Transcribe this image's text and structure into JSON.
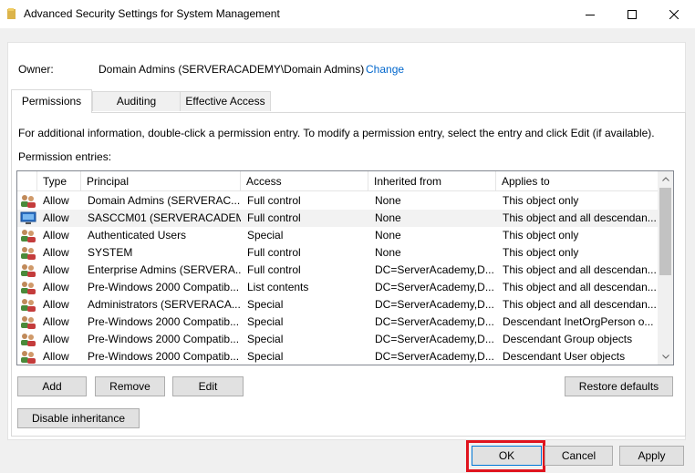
{
  "window": {
    "title": "Advanced Security Settings for System Management",
    "icon": "folder-icon"
  },
  "owner": {
    "label": "Owner:",
    "value": "Domain Admins (SERVERACADEMY\\Domain Admins)",
    "change_link": "Change"
  },
  "tabs": [
    {
      "label": "Permissions",
      "active": true
    },
    {
      "label": "Auditing",
      "active": false
    },
    {
      "label": "Effective Access",
      "active": false
    }
  ],
  "info_text": "For additional information, double-click a permission entry. To modify a permission entry, select the entry and click Edit (if available).",
  "entries_label": "Permission entries:",
  "columns": [
    "Type",
    "Principal",
    "Access",
    "Inherited from",
    "Applies to"
  ],
  "entries": [
    {
      "icon": "group-icon",
      "type": "Allow",
      "principal": "Domain Admins (SERVERAC...",
      "access": "Full control",
      "inherited": "None",
      "applies": "This object only"
    },
    {
      "icon": "computer-icon",
      "type": "Allow",
      "principal": "SASCCM01 (SERVERACADEM...",
      "access": "Full control",
      "inherited": "None",
      "applies": "This object and all descendan..."
    },
    {
      "icon": "group-icon",
      "type": "Allow",
      "principal": "Authenticated Users",
      "access": "Special",
      "inherited": "None",
      "applies": "This object only"
    },
    {
      "icon": "group-icon",
      "type": "Allow",
      "principal": "SYSTEM",
      "access": "Full control",
      "inherited": "None",
      "applies": "This object only"
    },
    {
      "icon": "group-icon",
      "type": "Allow",
      "principal": "Enterprise Admins (SERVERA...",
      "access": "Full control",
      "inherited": "DC=ServerAcademy,D...",
      "applies": "This object and all descendan..."
    },
    {
      "icon": "group-icon",
      "type": "Allow",
      "principal": "Pre-Windows 2000 Compatib...",
      "access": "List contents",
      "inherited": "DC=ServerAcademy,D...",
      "applies": "This object and all descendan..."
    },
    {
      "icon": "group-icon",
      "type": "Allow",
      "principal": "Administrators (SERVERACA...",
      "access": "Special",
      "inherited": "DC=ServerAcademy,D...",
      "applies": "This object and all descendan..."
    },
    {
      "icon": "group-icon",
      "type": "Allow",
      "principal": "Pre-Windows 2000 Compatib...",
      "access": "Special",
      "inherited": "DC=ServerAcademy,D...",
      "applies": "Descendant InetOrgPerson o..."
    },
    {
      "icon": "group-icon",
      "type": "Allow",
      "principal": "Pre-Windows 2000 Compatib...",
      "access": "Special",
      "inherited": "DC=ServerAcademy,D...",
      "applies": "Descendant Group objects"
    },
    {
      "icon": "group-icon",
      "type": "Allow",
      "principal": "Pre-Windows 2000 Compatib...",
      "access": "Special",
      "inherited": "DC=ServerAcademy,D...",
      "applies": "Descendant User objects"
    }
  ],
  "buttons": {
    "add": "Add",
    "remove": "Remove",
    "edit": "Edit",
    "restore": "Restore defaults",
    "disable_inheritance": "Disable inheritance",
    "ok": "OK",
    "cancel": "Cancel",
    "apply": "Apply"
  },
  "colors": {
    "link": "#0066cc",
    "highlight_border": "#e0141e",
    "default_button_border": "#0078d7"
  }
}
